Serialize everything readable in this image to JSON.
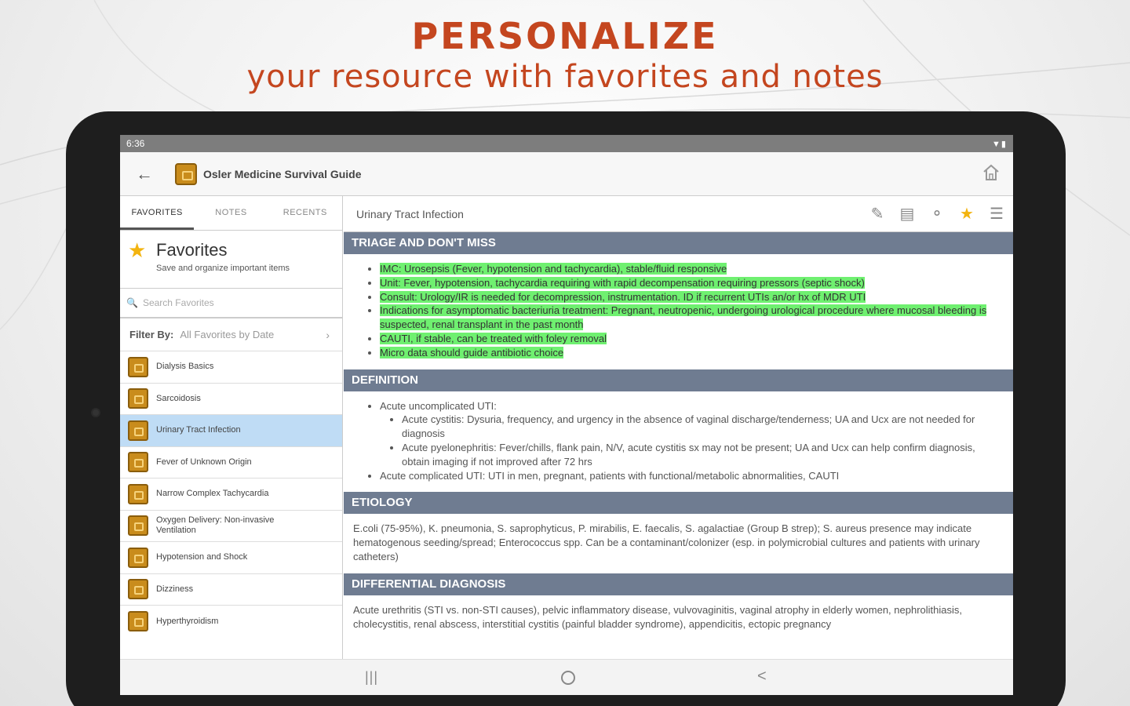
{
  "promo": {
    "headline": "PERSONALIZE",
    "subheadline": "your resource with favorites and notes"
  },
  "status_bar": {
    "time": "6:36",
    "icons": "▼▮"
  },
  "app_bar": {
    "title": "Osler Medicine Survival Guide"
  },
  "left_pane": {
    "tabs": [
      {
        "label": "FAVORITES",
        "active": true
      },
      {
        "label": "NOTES",
        "active": false
      },
      {
        "label": "RECENTS",
        "active": false
      }
    ],
    "favorites_title": "Favorites",
    "favorites_subtitle": "Save and organize important items",
    "search_placeholder": "Search Favorites",
    "filter_label": "Filter By:",
    "filter_value": "All Favorites by Date",
    "items": [
      {
        "label": "Dialysis Basics"
      },
      {
        "label": "Sarcoidosis"
      },
      {
        "label": "Urinary Tract Infection",
        "selected": true
      },
      {
        "label": "Fever of Unknown Origin"
      },
      {
        "label": "Narrow Complex Tachycardia"
      },
      {
        "label": "Oxygen Delivery: Non-invasive Ventilation"
      },
      {
        "label": "Hypotension and Shock"
      },
      {
        "label": "Dizziness"
      },
      {
        "label": "Hyperthyroidism"
      }
    ]
  },
  "content": {
    "title": "Urinary Tract Infection",
    "sections": {
      "triage": {
        "heading": "TRIAGE AND DON'T MISS",
        "bullets": [
          "IMC: Urosepsis (Fever, hypotension and tachycardia), stable/fluid responsive",
          "Unit: Fever, hypotension, tachycardia requiring with rapid decompensation requiring pressors (septic shock)",
          "Consult: Urology/IR is needed for decompression, instrumentation. ID if recurrent UTIs an/or hx of MDR UTI",
          "Indications for asymptomatic bacteriuria treatment: Pregnant, neutropenic, undergoing urological procedure where mucosal bleeding is suspected, renal transplant in the past month",
          "CAUTI, if stable, can be treated with foley removal",
          "Micro data should guide antibiotic choice"
        ]
      },
      "definition": {
        "heading": "DEFINITION",
        "item1": "Acute uncomplicated UTI:",
        "sub1": "Acute cystitis: Dysuria, frequency, and urgency in the absence of vaginal discharge/tenderness; UA and Ucx are not needed for diagnosis",
        "sub2": "Acute pyelonephritis: Fever/chills, flank pain, N/V, acute cystitis sx may not be present; UA and Ucx can help confirm diagnosis, obtain imaging if not improved after 72 hrs",
        "item2": "Acute complicated UTI: UTI in men, pregnant, patients with functional/metabolic abnormalities, CAUTI"
      },
      "etiology": {
        "heading": "ETIOLOGY",
        "text": "E.coli (75-95%), K. pneumonia, S. saprophyticus, P. mirabilis, E. faecalis, S. agalactiae (Group B strep); S. aureus presence may indicate hematogenous seeding/spread; Enterococcus spp. Can be a contaminant/colonizer (esp. in polymicrobial cultures and patients with urinary catheters)"
      },
      "differential": {
        "heading": "DIFFERENTIAL DIAGNOSIS",
        "text": "Acute urethritis (STI vs. non-STI causes), pelvic inflammatory disease, vulvovaginitis, vaginal atrophy in elderly women, nephrolithiasis, cholecystitis, renal abscess, interstitial cystitis (painful bladder syndrome), appendicitis, ectopic pregnancy"
      }
    }
  },
  "nav_bar": {
    "recents": "|||",
    "back": "<"
  },
  "colors": {
    "brand": "#c4461f",
    "section_bar": "#6f7c91",
    "highlight": "#6ff070",
    "selected_row": "#bfdcf5",
    "star": "#f3b410"
  }
}
